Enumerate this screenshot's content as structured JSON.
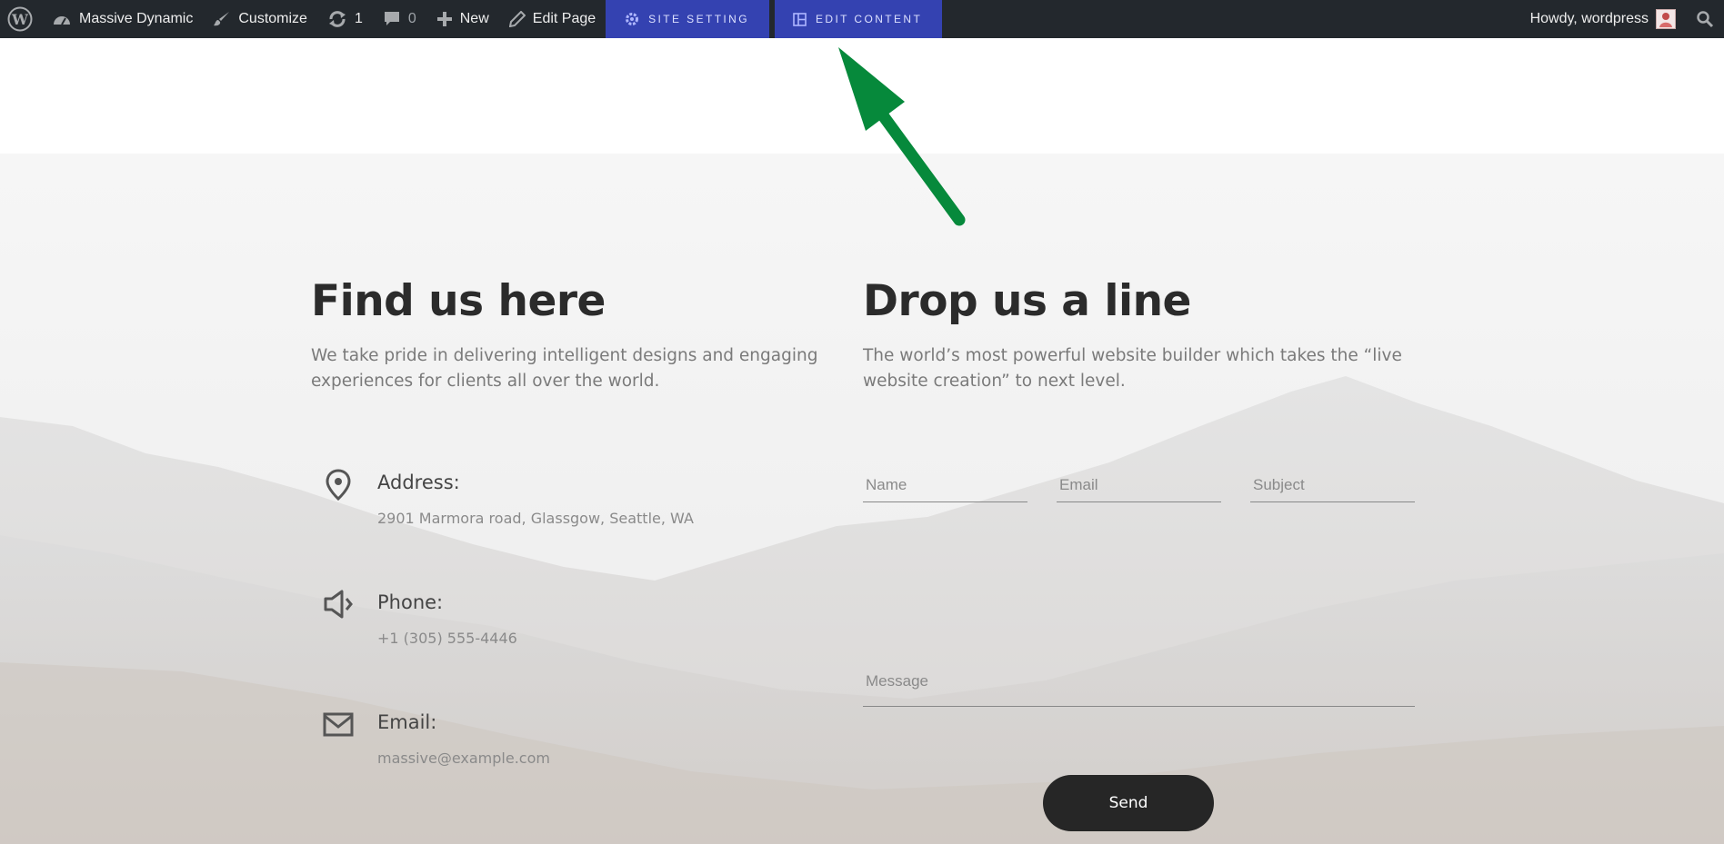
{
  "admin_bar": {
    "site_name": "Massive Dynamic",
    "customize_label": "Customize",
    "updates_count": "1",
    "comments_count": "0",
    "new_label": "New",
    "edit_page_label": "Edit Page",
    "site_setting_label": "SITE SETTING",
    "edit_content_label": "EDIT CONTENT",
    "greeting": "Howdy, wordpress"
  },
  "find_us": {
    "title": "Find us here",
    "lead": "We take pride in delivering intelligent designs and engaging experiences for clients all over the world.",
    "items": [
      {
        "icon": "location-pin-icon",
        "label": "Address:",
        "value": "2901 Marmora road, Glassgow, Seattle, WA"
      },
      {
        "icon": "megaphone-icon",
        "label": "Phone:",
        "value": "+1 (305) 555-4446"
      },
      {
        "icon": "envelope-icon",
        "label": "Email:",
        "value": "massive@example.com"
      }
    ]
  },
  "drop_line": {
    "title": "Drop us a line",
    "lead": "The world’s most powerful website builder which takes the “live website creation” to next level.",
    "form": {
      "name_placeholder": "Name",
      "email_placeholder": "Email",
      "subject_placeholder": "Subject",
      "message_placeholder": "Message",
      "send_label": "Send"
    }
  },
  "colors": {
    "admin_bar_bg": "#23282d",
    "builder_button_bg": "#3442b1",
    "arrow": "#06893b",
    "heading": "#2b2b2b",
    "send_button_bg": "#262626"
  }
}
